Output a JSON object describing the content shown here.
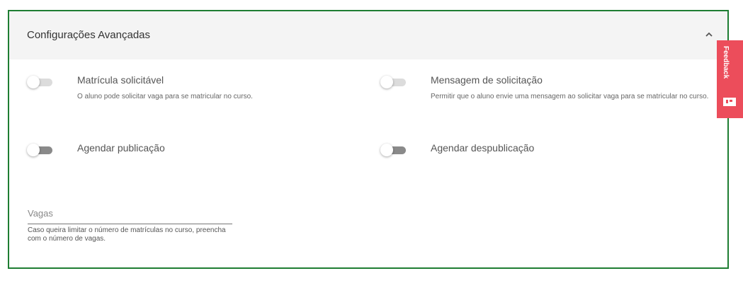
{
  "panel": {
    "title": "Configurações Avançadas",
    "collapse_icon": "chevron-up-icon"
  },
  "options": {
    "matricula": {
      "title": "Matrícula solicitável",
      "description": "O aluno pode solicitar vaga para se matricular no curso.",
      "enabled": false
    },
    "mensagem": {
      "title": "Mensagem de solicitação",
      "description": "Permitir que o aluno envie uma mensagem ao solicitar vaga para se matricular no curso.",
      "enabled": false
    },
    "agendar_publicacao": {
      "title": "Agendar publicação",
      "enabled": false
    },
    "agendar_despublicacao": {
      "title": "Agendar despublicação",
      "enabled": false
    }
  },
  "vagas": {
    "label": "Vagas",
    "value": "",
    "help": "Caso queira limitar o número de matrículas no curso, preencha com o número de vagas."
  },
  "feedback": {
    "label": "Feedback",
    "icon": "feedback-icon",
    "color": "#ec4d5b"
  },
  "colors": {
    "border": "#1e7d32",
    "header_bg": "#f4f4f4"
  }
}
